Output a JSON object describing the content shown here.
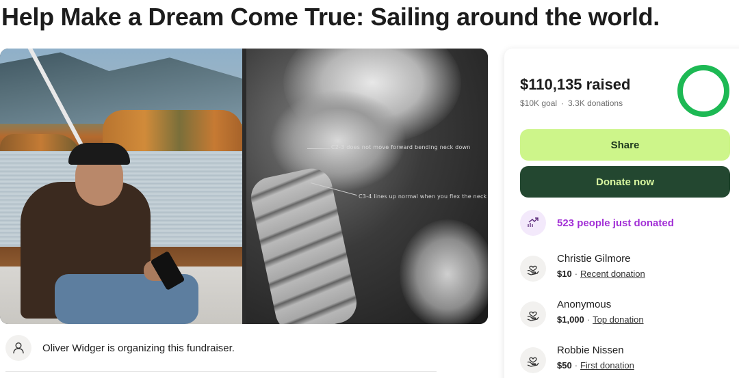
{
  "page": {
    "title": "Help Make a Dream Come True: Sailing around the world."
  },
  "hero": {
    "xray_note_1": "C2-3 does not move forward bending neck down",
    "xray_note_2": "C3-4 lines up normal when you flex the neck"
  },
  "organizer": {
    "text": "Oliver Widger is organizing this fundraiser.",
    "icon": "user-icon"
  },
  "donation_card": {
    "raised": "$110,135 raised",
    "goal": "$10K goal",
    "separator": "·",
    "donations": "3.3K donations",
    "progress_fraction": 1.0,
    "progress_color": "#1db954",
    "share_label": "Share",
    "donate_label": "Donate now",
    "colors": {
      "share_bg": "#cdf58a",
      "donate_bg": "#234730",
      "trend_text": "#a230d6"
    },
    "trend": {
      "icon": "trending-up-icon",
      "text": "523 people just donated"
    },
    "recent_donors": [
      {
        "name": "Christie Gilmore",
        "amount": "$10",
        "tag": "Recent donation",
        "icon": "heart-hand-icon"
      },
      {
        "name": "Anonymous",
        "amount": "$1,000",
        "tag": "Top donation",
        "icon": "heart-hand-icon"
      },
      {
        "name": "Robbie Nissen",
        "amount": "$50",
        "tag": "First donation",
        "icon": "heart-hand-icon"
      }
    ]
  }
}
